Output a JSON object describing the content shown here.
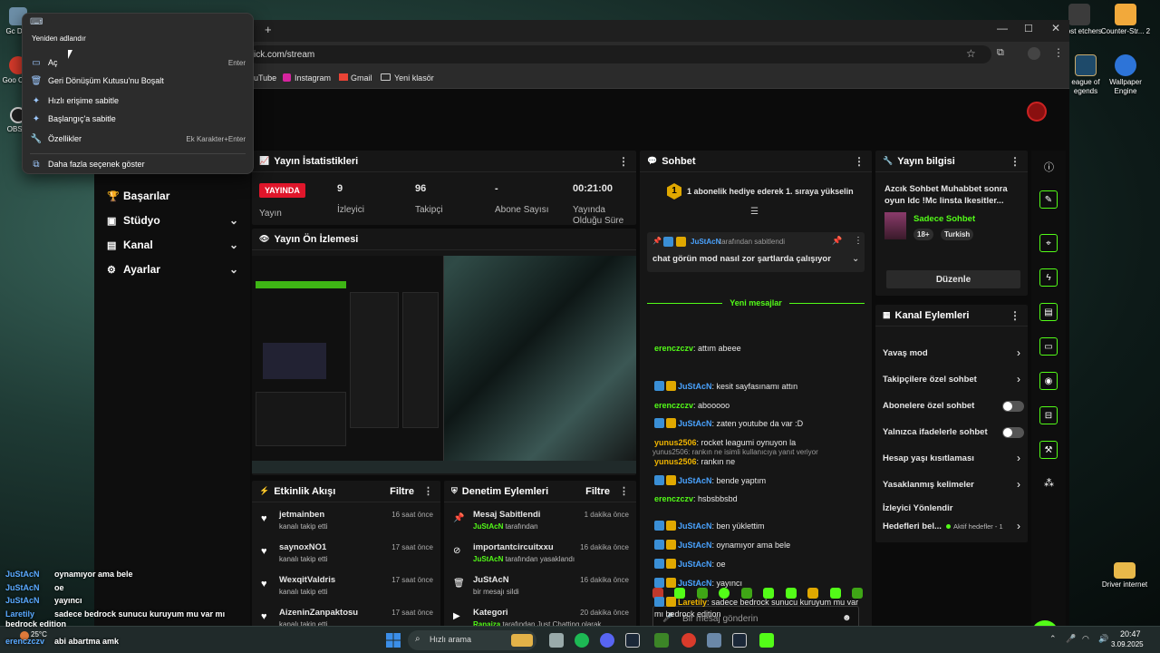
{
  "desktop": {
    "icons_left": [
      "Gc Dön",
      "Goo Chro",
      "OBS S"
    ],
    "icons_right": [
      {
        "label": "Ghost etchers"
      },
      {
        "label": "Counter-Str... 2"
      },
      {
        "label": "eague of egends"
      },
      {
        "label": "Wallpaper Engine"
      },
      {
        "label": "Driver internet"
      }
    ],
    "chat_overlay": [
      {
        "user": "JuStAcN",
        "text": "oynamıyor ama bele"
      },
      {
        "user": "JuStAcN",
        "text": "oe"
      },
      {
        "user": "JuStAcN",
        "text": "yayıncı"
      },
      {
        "user": "Laretily",
        "text": "sadece bedrock sunucu kuruyum mu var mı bedrock edition"
      },
      {
        "user": "erenczczv",
        "text": "abi abartma amk"
      }
    ],
    "weather": "25°C"
  },
  "context_menu": {
    "rename_tooltip": "Yeniden adlandır",
    "items": [
      {
        "label": "Aç",
        "shortcut": "Enter",
        "icon": "folder-icon"
      },
      {
        "label": "Geri Dönüşüm Kutusu'nu Boşalt",
        "shortcut": "",
        "icon": "trash-icon"
      },
      {
        "label": "Hızlı erişime sabitle",
        "shortcut": "",
        "icon": "pin-icon"
      },
      {
        "label": "Başlangıç'a sabitle",
        "shortcut": "",
        "icon": "pin-icon"
      },
      {
        "label": "Özellikler",
        "shortcut": "Ek Karakter+Enter",
        "icon": "wrench-icon"
      },
      {
        "label": "Daha fazla seçenek göster",
        "shortcut": "",
        "icon": "more-options-icon"
      }
    ]
  },
  "browser": {
    "url": "ick.com/stream",
    "bookmarks": [
      "uTube",
      "Instagram",
      "Gmail",
      "Yeni klasör"
    ]
  },
  "nav": [
    {
      "label": "Başarılar",
      "chevron": false
    },
    {
      "label": "Stüdyo",
      "chevron": true
    },
    {
      "label": "Kanal",
      "chevron": true
    },
    {
      "label": "Ayarlar",
      "chevron": true
    }
  ],
  "stats": {
    "title": "Yayın İstatistikleri",
    "live_badge": "YAYINDA",
    "live_label": "Yayın",
    "items": [
      {
        "value": "9",
        "label": "İzleyici"
      },
      {
        "value": "96",
        "label": "Takipçi"
      },
      {
        "value": "-",
        "label": "Abone Sayısı"
      },
      {
        "value": "00:21:00",
        "label": "Yayında Olduğu Süre"
      }
    ]
  },
  "preview": {
    "title": "Yayın Ön İzlemesi"
  },
  "activity": {
    "title": "Etkinlik Akışı",
    "filter": "Filtre",
    "items": [
      {
        "name": "jetmainben",
        "sub": "kanalı takip etti",
        "time": "16 saat önce"
      },
      {
        "name": "saynoxNO1",
        "sub": "kanalı takip etti",
        "time": "17 saat önce"
      },
      {
        "name": "WexqitValdris",
        "sub": "kanalı takip etti",
        "time": "17 saat önce"
      },
      {
        "name": "AizeninZanpaktosu",
        "sub": "kanalı takip etti",
        "time": "17 saat önce"
      }
    ]
  },
  "moderation": {
    "title": "Denetim Eylemleri",
    "filter": "Filtre",
    "items": [
      {
        "title": "Mesaj Sabitlendi",
        "actor": "JuStAcN",
        "sub": " tarafından",
        "time": "1 dakika önce"
      },
      {
        "title": "importantcircuitxxu",
        "actor": "JuStAcN",
        "sub": " tarafından yasaklandı",
        "time": "16 dakika önce"
      },
      {
        "title": "JuStAcN",
        "actor": "",
        "sub": "bir mesajı sildi",
        "time": "16 dakika önce"
      },
      {
        "title": "Kategori",
        "actor": "Ranaiza",
        "sub": " tarafından Just Chatting olarak değiştirildi",
        "time": "20 dakika önce"
      }
    ]
  },
  "chat": {
    "title": "Sohbet",
    "gift_banner": "1 abonelik hediye ederek 1. sıraya yükselin",
    "pinned_by": "JuStAcN",
    "pinned_by_suffix": " tarafından sabitlendi",
    "pinned_text": "chat görün mod nasıl zor şartlarda çalışıyor",
    "new_messages": "Yeni mesajlar",
    "reply_hint": "yunus2506: rankın ne isimli kullanıcıya yanıt veriyor",
    "messages_before": [
      {
        "user": "erenczczv",
        "text": "attım abeee",
        "color": "green",
        "badges": false
      }
    ],
    "messages": [
      {
        "user": "JuStAcN",
        "text": "kesit sayfasınamı attın",
        "color": "blue",
        "badges": true
      },
      {
        "user": "erenczczv",
        "text": "abooooo",
        "color": "green",
        "badges": false
      },
      {
        "user": "JuStAcN",
        "text": "zaten youtube da var :D",
        "color": "blue",
        "badges": true
      },
      {
        "user": "yunus2506",
        "text": "rocket leagumi oynuyon la",
        "color": "gold",
        "badges": false
      },
      {
        "user": "yunus2506",
        "text": "rankın ne",
        "color": "gold",
        "badges": false
      },
      {
        "user": "JuStAcN",
        "text": "bende yaptım",
        "color": "blue",
        "badges": true
      },
      {
        "user": "erenczczv",
        "text": "hsbsbbsbd",
        "color": "green",
        "badges": false
      }
    ],
    "messages_after": [
      {
        "user": "JuStAcN",
        "text": "ben yüklettim",
        "color": "blue",
        "badges": true
      },
      {
        "user": "JuStAcN",
        "text": "oynamıyor ama bele",
        "color": "blue",
        "badges": true
      },
      {
        "user": "JuStAcN",
        "text": "oe",
        "color": "blue",
        "badges": true
      },
      {
        "user": "JuStAcN",
        "text": "yayıncı",
        "color": "blue",
        "badges": true
      },
      {
        "user": "Laretily",
        "text": "sadece bedrock sunucu kuruyum mu var mı bedrock edition",
        "color": "gold",
        "badges": true
      },
      {
        "user": "erenczczv",
        "text": "abi abartma amk",
        "color": "green",
        "badges": false
      }
    ],
    "input_placeholder": "Bir mesaj gönderin",
    "send": "Gönder"
  },
  "stream_info": {
    "title": "Yayın bilgisi",
    "stream_title": "Azcık Sohbet Muhabbet sonra oyun ldc !Mc linsta lkesitler...",
    "category": "Sadece Sohbet",
    "tags": [
      "18+",
      "Turkish"
    ],
    "edit": "Düzenle"
  },
  "channel_actions": {
    "title": "Kanal Eylemleri",
    "items": [
      {
        "label": "Yavaş mod",
        "control": "chevron"
      },
      {
        "label": "Takipçilere özel sohbet",
        "control": "chevron"
      },
      {
        "label": "Abonelere özel sohbet",
        "control": "toggle"
      },
      {
        "label": "Yalnızca ifadelerle sohbet",
        "control": "toggle"
      },
      {
        "label": "Hesap yaşı kısıtlaması",
        "control": "chevron"
      },
      {
        "label": "Yasaklanmış kelimeler",
        "control": "chevron"
      },
      {
        "label": "İzleyici Yönlendir",
        "control": "none"
      }
    ],
    "targets_label": "Hedefleri bel...",
    "targets_status": "Aktif hedefler - 1"
  },
  "taskbar": {
    "search": "Hızlı arama",
    "time": "20:47",
    "date": "3.09.2025"
  },
  "colors": {
    "accent": "#53fc18",
    "live": "#e0162b",
    "bg": "#0b0b0b",
    "panel": "#161616"
  }
}
